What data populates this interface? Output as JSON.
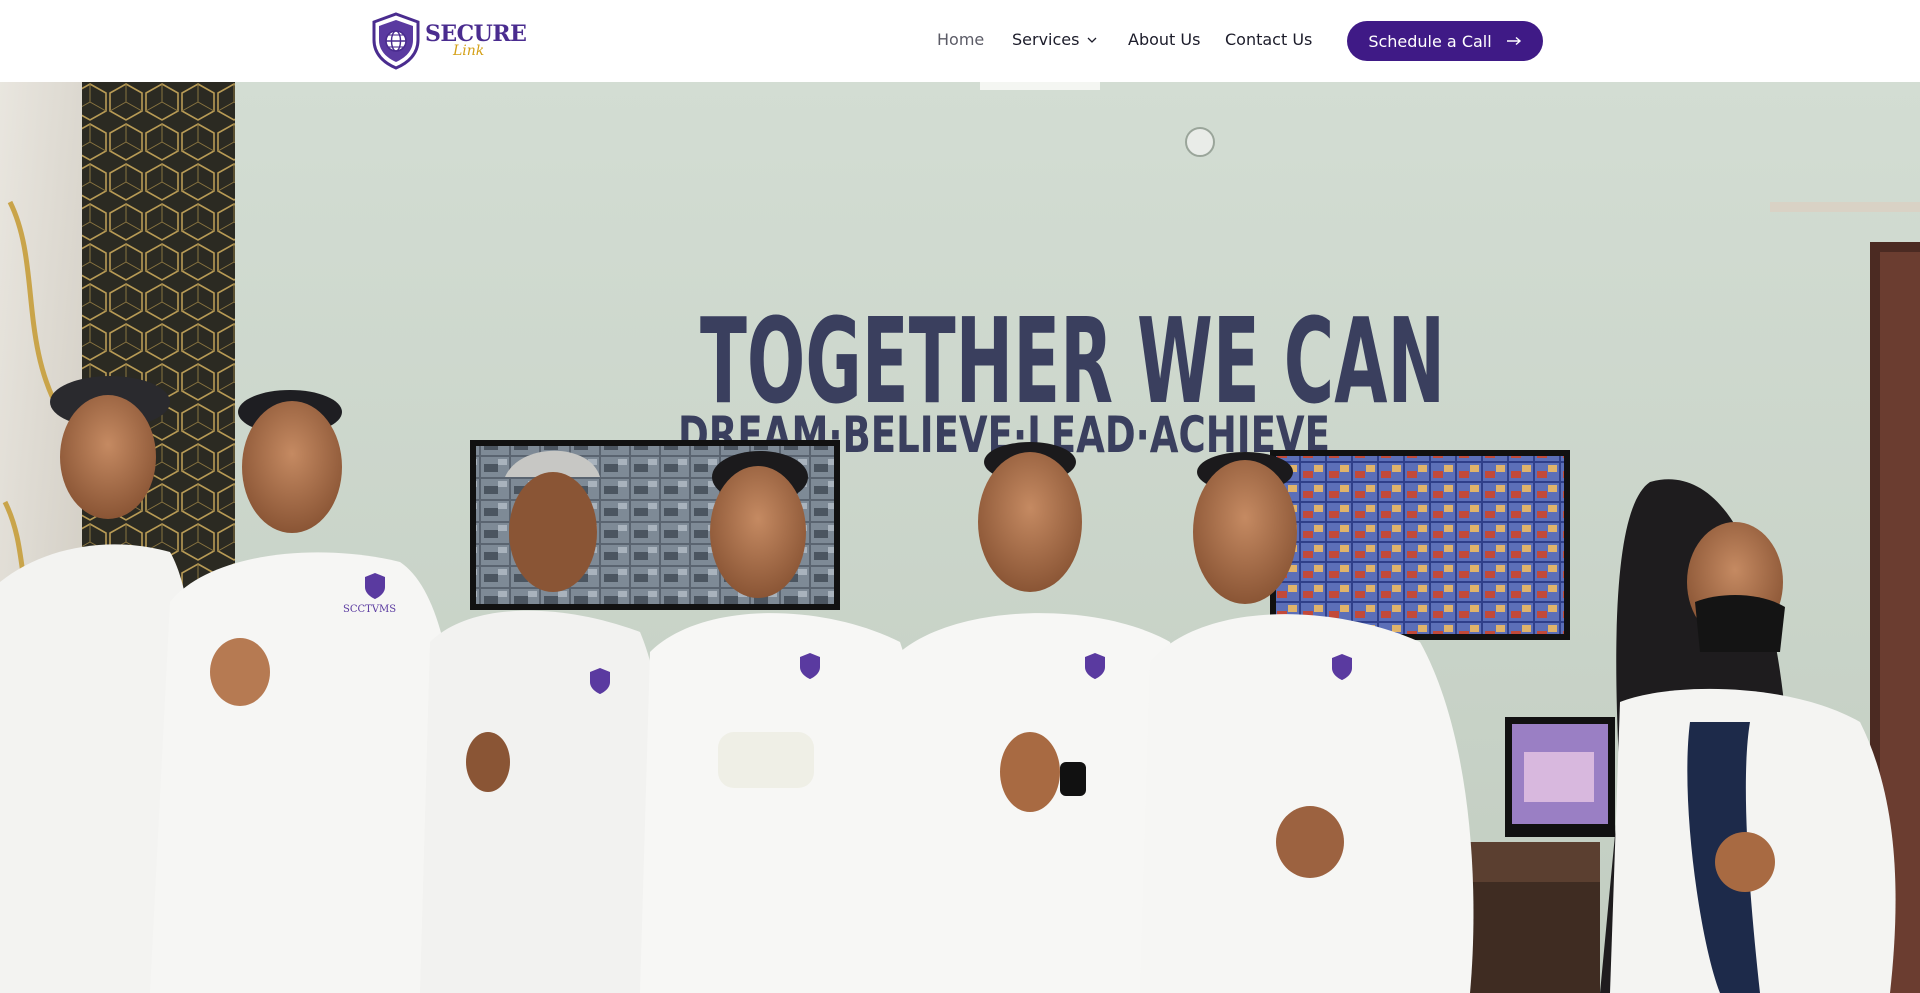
{
  "brand": {
    "name": "SECURE",
    "tagline": "Link",
    "logo_icon": "shield-globe-icon",
    "colors": {
      "primary": "#3f1a86",
      "logo_purple": "#4a2c8f",
      "logo_gold": "#d4a017"
    }
  },
  "nav": {
    "items": [
      {
        "label": "Home",
        "active": true
      },
      {
        "label": "Services",
        "has_dropdown": true,
        "icon": "chevron-down-icon"
      },
      {
        "label": "About Us"
      },
      {
        "label": "Contact Us"
      }
    ],
    "cta_label": "Schedule a Call",
    "cta_icon": "arrow-right-icon"
  },
  "hero": {
    "wall_headline": "TOGETHER WE CAN",
    "wall_subline": "DREAM·BELIEVE·LEAD·ACHIEVE",
    "shirt_logo_text": "SCCTVMS"
  }
}
